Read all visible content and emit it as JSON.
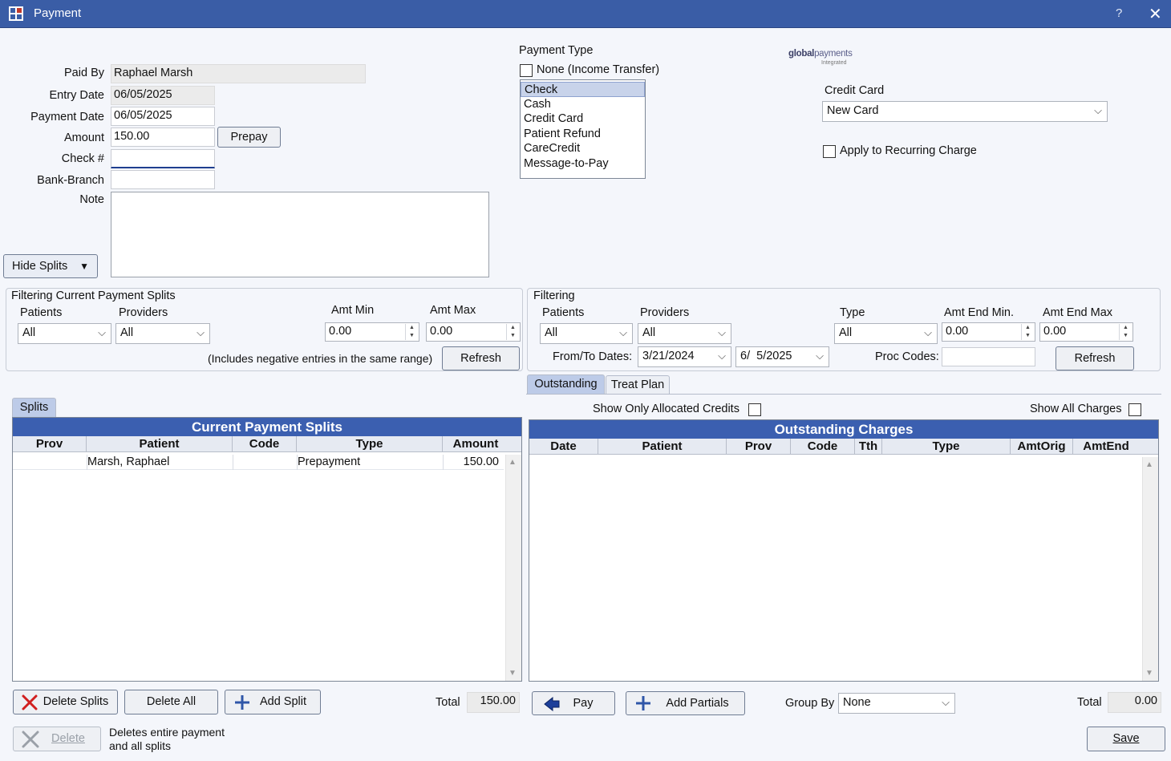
{
  "window": {
    "title": "Payment",
    "help": "?",
    "close": "✕"
  },
  "form": {
    "paid_by_label": "Paid By",
    "paid_by": "Raphael Marsh",
    "entry_date_label": "Entry Date",
    "entry_date": "06/05/2025",
    "payment_date_label": "Payment Date",
    "payment_date": "06/05/2025",
    "amount_label": "Amount",
    "amount": "150.00",
    "prepay_label": "Prepay",
    "check_label": "Check #",
    "check": "",
    "bank_branch_label": "Bank-Branch",
    "bank_branch": "",
    "note_label": "Note",
    "note": "",
    "hide_splits_label": "Hide Splits"
  },
  "payment_type": {
    "label": "Payment Type",
    "none_label": "None (Income Transfer)",
    "options": [
      "Check",
      "Cash",
      "Credit Card",
      "Patient Refund",
      "CareCredit",
      "Message-to-Pay"
    ],
    "selected": "Check"
  },
  "processor": {
    "logo_text_bold": "global",
    "logo_text": "payments",
    "logo_sub": "Integrated",
    "credit_card_label": "Credit Card",
    "credit_card_value": "New Card",
    "recurring_label": "Apply to Recurring Charge"
  },
  "filter_splits": {
    "title": "Filtering Current Payment Splits",
    "patients_label": "Patients",
    "patients_value": "All",
    "providers_label": "Providers",
    "providers_value": "All",
    "amt_min_label": "Amt Min",
    "amt_min": "0.00",
    "amt_max_label": "Amt Max",
    "amt_max": "0.00",
    "note": "(Includes negative entries in the same range)",
    "refresh_label": "Refresh"
  },
  "filter_charges": {
    "title": "Filtering",
    "patients_label": "Patients",
    "patients_value": "All",
    "providers_label": "Providers",
    "providers_value": "All",
    "type_label": "Type",
    "type_value": "All",
    "amt_end_min_label": "Amt End Min.",
    "amt_end_min": "0.00",
    "amt_end_max_label": "Amt End Max",
    "amt_end_max": "0.00",
    "dates_label": "From/To Dates:",
    "from_date": "3/21/2024",
    "to_date": "6/  5/2025",
    "proc_codes_label": "Proc Codes:",
    "proc_codes": "",
    "refresh_label": "Refresh"
  },
  "splits": {
    "tab": "Splits",
    "grid_title": "Current Payment Splits",
    "columns": [
      "Prov",
      "Patient",
      "Code",
      "Type",
      "Amount"
    ],
    "rows": [
      {
        "prov": "",
        "patient": "Marsh, Raphael",
        "code": "",
        "type": "Prepayment",
        "amount": "150.00"
      }
    ],
    "delete_splits_label": "Delete Splits",
    "delete_all_label": "Delete All",
    "add_split_label": "Add Split",
    "total_label": "Total",
    "total": "150.00"
  },
  "charges": {
    "tabs": [
      "Outstanding",
      "Treat Plan"
    ],
    "show_allocated_label": "Show Only Allocated Credits",
    "show_all_label": "Show All Charges",
    "grid_title": "Outstanding Charges",
    "columns": [
      "Date",
      "Patient",
      "Prov",
      "Code",
      "Tth",
      "Type",
      "AmtOrig",
      "AmtEnd"
    ],
    "pay_label": "Pay",
    "add_partials_label": "Add Partials",
    "group_by_label": "Group By",
    "group_by_value": "None",
    "total_label": "Total",
    "total": "0.00"
  },
  "footer": {
    "delete_label": "Delete",
    "delete_note_1": "Deletes entire payment",
    "delete_note_2": "and all splits",
    "save_label": "Save"
  }
}
